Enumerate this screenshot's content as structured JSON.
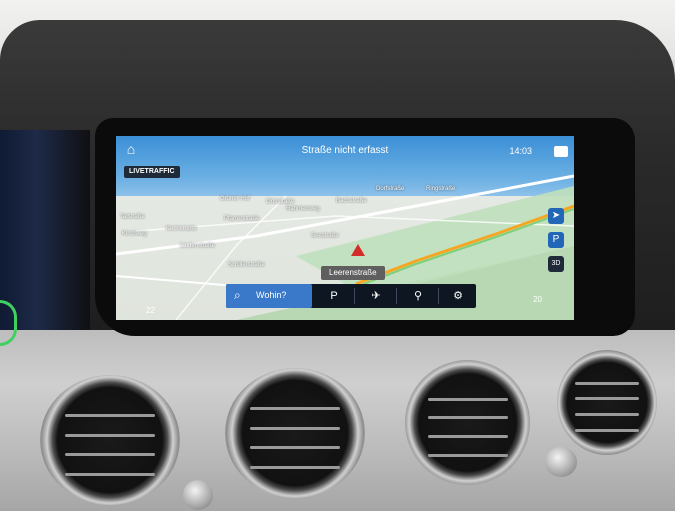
{
  "nav": {
    "status_title": "Straße nicht erfasst",
    "clock": "14:03",
    "live_badge": "LIVETRAFFIC",
    "current_street": "Leerenstraße",
    "search_label": "Wohin?",
    "temp_left": "22",
    "temp_right": "20",
    "side_buttons": [
      "compass-icon",
      "parking-icon",
      "3d-view-icon"
    ],
    "side_3d_label": "3D",
    "toolbar_icons": [
      "search-icon",
      "poi-filter-icon",
      "mute-guidance-icon",
      "route-icon",
      "settings-gear-icon"
    ]
  },
  "map_labels": [
    "Grüner Hof",
    "Ortsstraße",
    "Rahmenweg",
    "Pfarrerstraße",
    "Talstraße",
    "Kirchweg",
    "Kirchstraße",
    "Lindenstraße",
    "Schillerstraße",
    "Seestraße",
    "Bachstraße",
    "Dorfstraße",
    "Ringstraße"
  ],
  "colors": {
    "live_badge_bg": "#1e2a38",
    "search_accent": "#3a78c9",
    "side_button": "#2266b8",
    "route_line": "#f5a623",
    "ambient_light": "#3fd060"
  }
}
